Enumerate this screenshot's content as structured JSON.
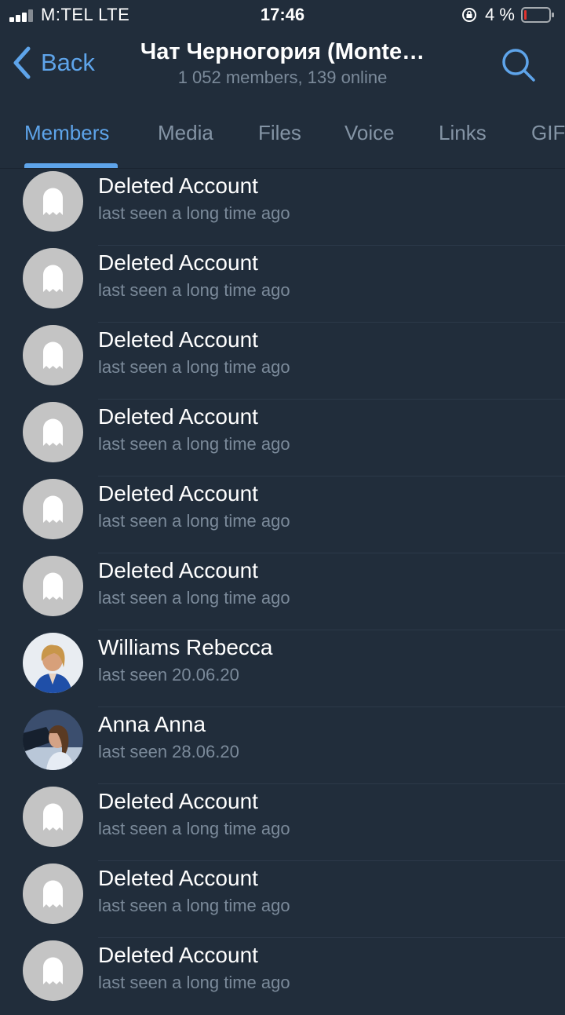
{
  "status_bar": {
    "carrier": "M:TEL  LTE",
    "time": "17:46",
    "battery_percent": "4 %"
  },
  "header": {
    "back_label": "Back",
    "title": "Чат Черногория (Monte…",
    "subtitle": "1 052 members, 139 online"
  },
  "tabs": [
    {
      "label": "Members",
      "active": true
    },
    {
      "label": "Media"
    },
    {
      "label": "Files"
    },
    {
      "label": "Voice"
    },
    {
      "label": "Links"
    },
    {
      "label": "GIF"
    }
  ],
  "members": [
    {
      "name": "Deleted Account",
      "status": "last seen a long time ago",
      "avatar": "ghost-icon"
    },
    {
      "name": "Deleted Account",
      "status": "last seen a long time ago",
      "avatar": "ghost-icon"
    },
    {
      "name": "Deleted Account",
      "status": "last seen a long time ago",
      "avatar": "ghost-icon"
    },
    {
      "name": "Deleted Account",
      "status": "last seen a long time ago",
      "avatar": "ghost-icon"
    },
    {
      "name": "Deleted Account",
      "status": "last seen a long time ago",
      "avatar": "ghost-icon"
    },
    {
      "name": "Deleted Account",
      "status": "last seen a long time ago",
      "avatar": "ghost-icon"
    },
    {
      "name": "Williams Rebecca",
      "status": "last seen 20.06.20",
      "avatar": "photo"
    },
    {
      "name": "Anna Anna",
      "status": "last seen 28.06.20",
      "avatar": "photo"
    },
    {
      "name": "Deleted Account",
      "status": "last seen a long time ago",
      "avatar": "ghost-icon"
    },
    {
      "name": "Deleted Account",
      "status": "last seen a long time ago",
      "avatar": "ghost-icon"
    },
    {
      "name": "Deleted Account",
      "status": "last seen a long time ago",
      "avatar": "ghost-icon"
    }
  ],
  "colors": {
    "background": "#212d3b",
    "accent": "#5ea4ea",
    "secondary_text": "#7b8a9a",
    "battery_low": "#e0332f"
  }
}
